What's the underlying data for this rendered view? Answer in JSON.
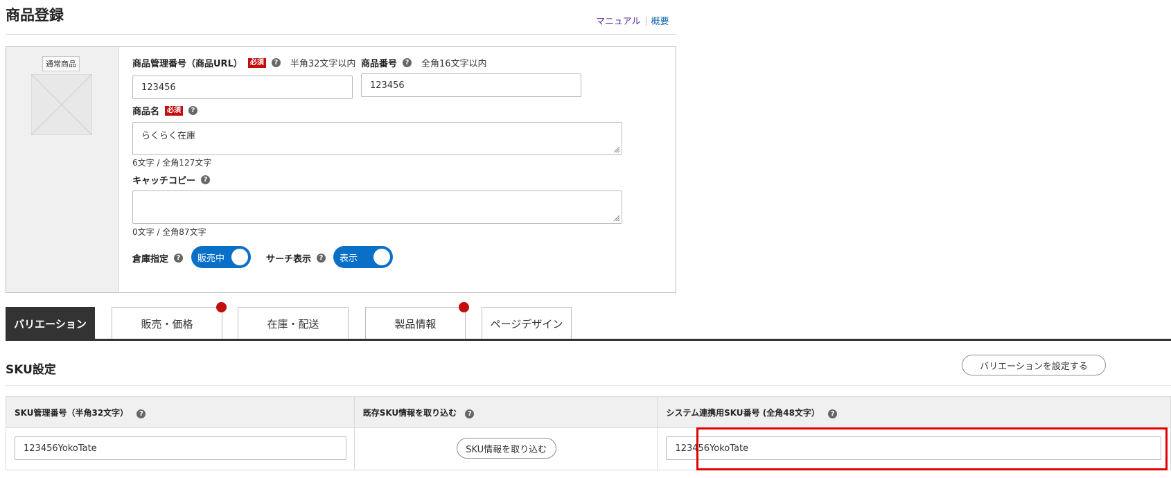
{
  "header": {
    "title": "商品登録",
    "manual_link": "マニュアル",
    "overview_link": "概要"
  },
  "product": {
    "badge": "通常商品",
    "mgmt_number": {
      "label": "商品管理番号（商品URL）",
      "required": "必須",
      "note": "半角32文字以内",
      "value": "123456"
    },
    "item_number": {
      "label": "商品番号",
      "note": "全角16文字以内",
      "value": "123456"
    },
    "name": {
      "label": "商品名",
      "required": "必須",
      "value": "らくらく在庫",
      "counter": "6文字 / 全角127文字"
    },
    "catch_copy": {
      "label": "キャッチコピー",
      "value": "",
      "counter": "0文字 / 全角87文字"
    },
    "warehouse": {
      "label": "倉庫指定",
      "toggle_label": "販売中",
      "on": true
    },
    "search_display": {
      "label": "サーチ表示",
      "toggle_label": "表示",
      "on": true
    },
    "help_icon": "?"
  },
  "tabs": [
    {
      "label": "バリエーション",
      "active": true
    },
    {
      "label": "販売・価格",
      "active": false,
      "alert": true
    },
    {
      "label": "在庫・配送",
      "active": false
    },
    {
      "label": "製品情報",
      "active": false,
      "alert": true
    },
    {
      "label": "ページデザイン",
      "active": false
    }
  ],
  "sku": {
    "title": "SKU設定",
    "set_variation_button": "バリエーションを設定する",
    "columns": [
      "SKU管理番号（半角32文字）",
      "既存SKU情報を取り込む",
      "システム連携用SKU番号 (全角48文字）"
    ],
    "row": {
      "sku_mgmt_number": "123456YokoTate",
      "import_button": "SKU情報を取り込む",
      "system_sku_number": "123456YokoTate"
    }
  },
  "colors": {
    "accent": "#0a6fc7",
    "required": "#c40d0d",
    "highlight": "#e00000"
  }
}
